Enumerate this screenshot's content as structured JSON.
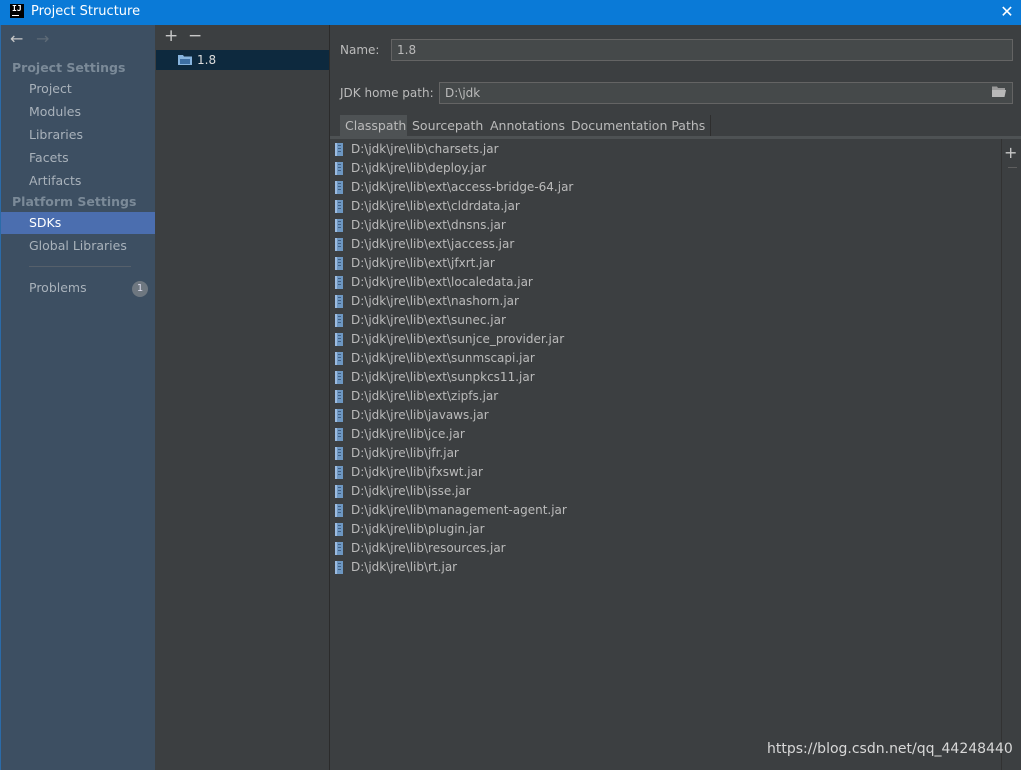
{
  "window": {
    "title": "Project Structure",
    "app_icon_text": "IJ"
  },
  "sidebar": {
    "project_settings_header": "Project Settings",
    "platform_settings_header": "Platform Settings",
    "items": [
      {
        "label": "Project"
      },
      {
        "label": "Modules"
      },
      {
        "label": "Libraries"
      },
      {
        "label": "Facets"
      },
      {
        "label": "Artifacts"
      },
      {
        "label": "SDKs"
      },
      {
        "label": "Global Libraries"
      },
      {
        "label": "Problems"
      }
    ],
    "problems_count": "1",
    "selected": "SDKs"
  },
  "sdk_list": {
    "add_symbol": "+",
    "remove_symbol": "−",
    "items": [
      {
        "label": "1.8"
      }
    ]
  },
  "sdk_detail": {
    "name_label": "Name:",
    "name_value": "1.8",
    "home_label": "JDK home path:",
    "home_value": "D:\\jdk",
    "tabs": [
      {
        "label": "Classpath"
      },
      {
        "label": "Sourcepath"
      },
      {
        "label": "Annotations"
      },
      {
        "label": "Documentation Paths"
      }
    ],
    "active_tab": "Classpath",
    "classpath": [
      "D:\\jdk\\jre\\lib\\charsets.jar",
      "D:\\jdk\\jre\\lib\\deploy.jar",
      "D:\\jdk\\jre\\lib\\ext\\access-bridge-64.jar",
      "D:\\jdk\\jre\\lib\\ext\\cldrdata.jar",
      "D:\\jdk\\jre\\lib\\ext\\dnsns.jar",
      "D:\\jdk\\jre\\lib\\ext\\jaccess.jar",
      "D:\\jdk\\jre\\lib\\ext\\jfxrt.jar",
      "D:\\jdk\\jre\\lib\\ext\\localedata.jar",
      "D:\\jdk\\jre\\lib\\ext\\nashorn.jar",
      "D:\\jdk\\jre\\lib\\ext\\sunec.jar",
      "D:\\jdk\\jre\\lib\\ext\\sunjce_provider.jar",
      "D:\\jdk\\jre\\lib\\ext\\sunmscapi.jar",
      "D:\\jdk\\jre\\lib\\ext\\sunpkcs11.jar",
      "D:\\jdk\\jre\\lib\\ext\\zipfs.jar",
      "D:\\jdk\\jre\\lib\\javaws.jar",
      "D:\\jdk\\jre\\lib\\jce.jar",
      "D:\\jdk\\jre\\lib\\jfr.jar",
      "D:\\jdk\\jre\\lib\\jfxswt.jar",
      "D:\\jdk\\jre\\lib\\jsse.jar",
      "D:\\jdk\\jre\\lib\\management-agent.jar",
      "D:\\jdk\\jre\\lib\\plugin.jar",
      "D:\\jdk\\jre\\lib\\resources.jar",
      "D:\\jdk\\jre\\lib\\rt.jar"
    ]
  },
  "watermark": "https://blog.csdn.net/qq_44248440",
  "icons": {
    "back": "arrow-left-icon",
    "forward": "arrow-right-icon",
    "close": "close-icon",
    "folder": "folder-icon",
    "jar": "jar-file-icon",
    "jdk": "jdk-folder-icon"
  },
  "colors": {
    "titlebar": "#0a7ad7",
    "sidebar_bg": "#3d4f62",
    "selection": "#4b6eaf",
    "panel_bg": "#3c3f41",
    "list_selection": "#0d293e"
  }
}
